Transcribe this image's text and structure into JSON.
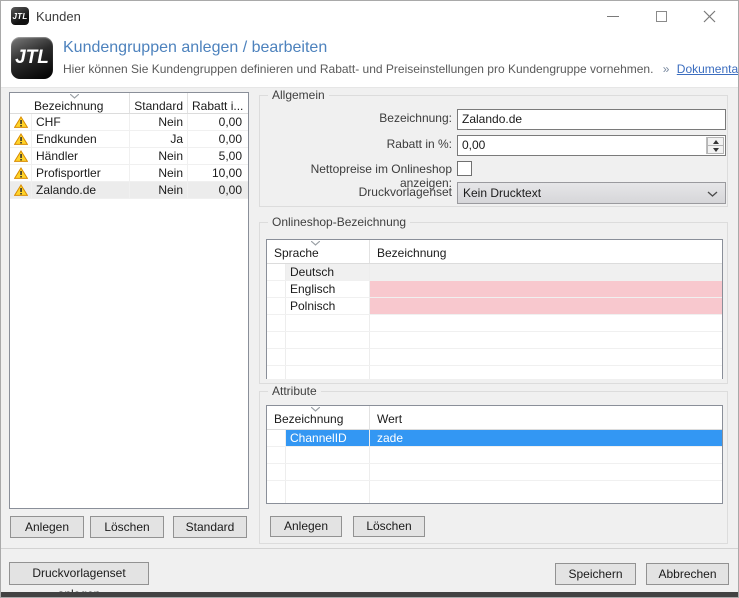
{
  "titlebar": {
    "icon": "JTL",
    "title": "Kunden"
  },
  "header": {
    "logo": "JTL",
    "title": "Kundengruppen anlegen / bearbeiten",
    "subtitle": "Hier können Sie Kundengruppen definieren und Rabatt- und Preiseinstellungen pro Kundengruppe vornehmen.",
    "link_arrow": "»",
    "link_label": "Dokumentation"
  },
  "kundengruppen_table": {
    "columns": {
      "bezeichnung": "Bezeichnung",
      "standard": "Standard",
      "rabatt": "Rabatt i..."
    },
    "rows": [
      {
        "bezeichnung": "CHF",
        "standard": "Nein",
        "rabatt": "0,00"
      },
      {
        "bezeichnung": "Endkunden",
        "standard": "Ja",
        "rabatt": "0,00"
      },
      {
        "bezeichnung": "Händler",
        "standard": "Nein",
        "rabatt": "5,00"
      },
      {
        "bezeichnung": "Profisportler",
        "standard": "Nein",
        "rabatt": "10,00"
      },
      {
        "bezeichnung": "Zalando.de",
        "standard": "Nein",
        "rabatt": "0,00"
      }
    ]
  },
  "kundengruppen_buttons": {
    "anlegen": "Anlegen",
    "loeschen": "Löschen",
    "standard": "Standard"
  },
  "allgemein": {
    "title": "Allgemein",
    "bezeichnung_label": "Bezeichnung:",
    "bezeichnung_value": "Zalando.de",
    "rabatt_label": "Rabatt in %:",
    "rabatt_value": "0,00",
    "nettopreise_label": "Nettopreise im Onlineshop anzeigen:",
    "druckvorlagenset_label": "Druckvorlagenset",
    "druckvorlagenset_value": "Kein Drucktext"
  },
  "onlineshop": {
    "title": "Onlineshop-Bezeichnung",
    "columns": {
      "sprache": "Sprache",
      "bezeichnung": "Bezeichnung"
    },
    "rows": [
      {
        "sprache": "Deutsch",
        "bezeichnung": ""
      },
      {
        "sprache": "Englisch",
        "bezeichnung": ""
      },
      {
        "sprache": "Polnisch",
        "bezeichnung": ""
      }
    ]
  },
  "attribute": {
    "title": "Attribute",
    "columns": {
      "bezeichnung": "Bezeichnung",
      "wert": "Wert"
    },
    "rows": [
      {
        "bezeichnung": "ChannelID",
        "wert": "zade"
      }
    ],
    "buttons": {
      "anlegen": "Anlegen",
      "loeschen": "Löschen"
    }
  },
  "footer": {
    "druckvorlagenset_anlegen": "Druckvorlagenset anlegen",
    "speichern": "Speichern",
    "abbrechen": "Abbrechen"
  },
  "colors": {
    "selection_blue": "#3397f3",
    "invalid_pink": "#f8c8ce",
    "selected_row_gray": "#ececec",
    "header_title_blue": "#4d82bd",
    "link_blue": "#3b6dbf",
    "warning_yellow": "#ffd42a"
  }
}
